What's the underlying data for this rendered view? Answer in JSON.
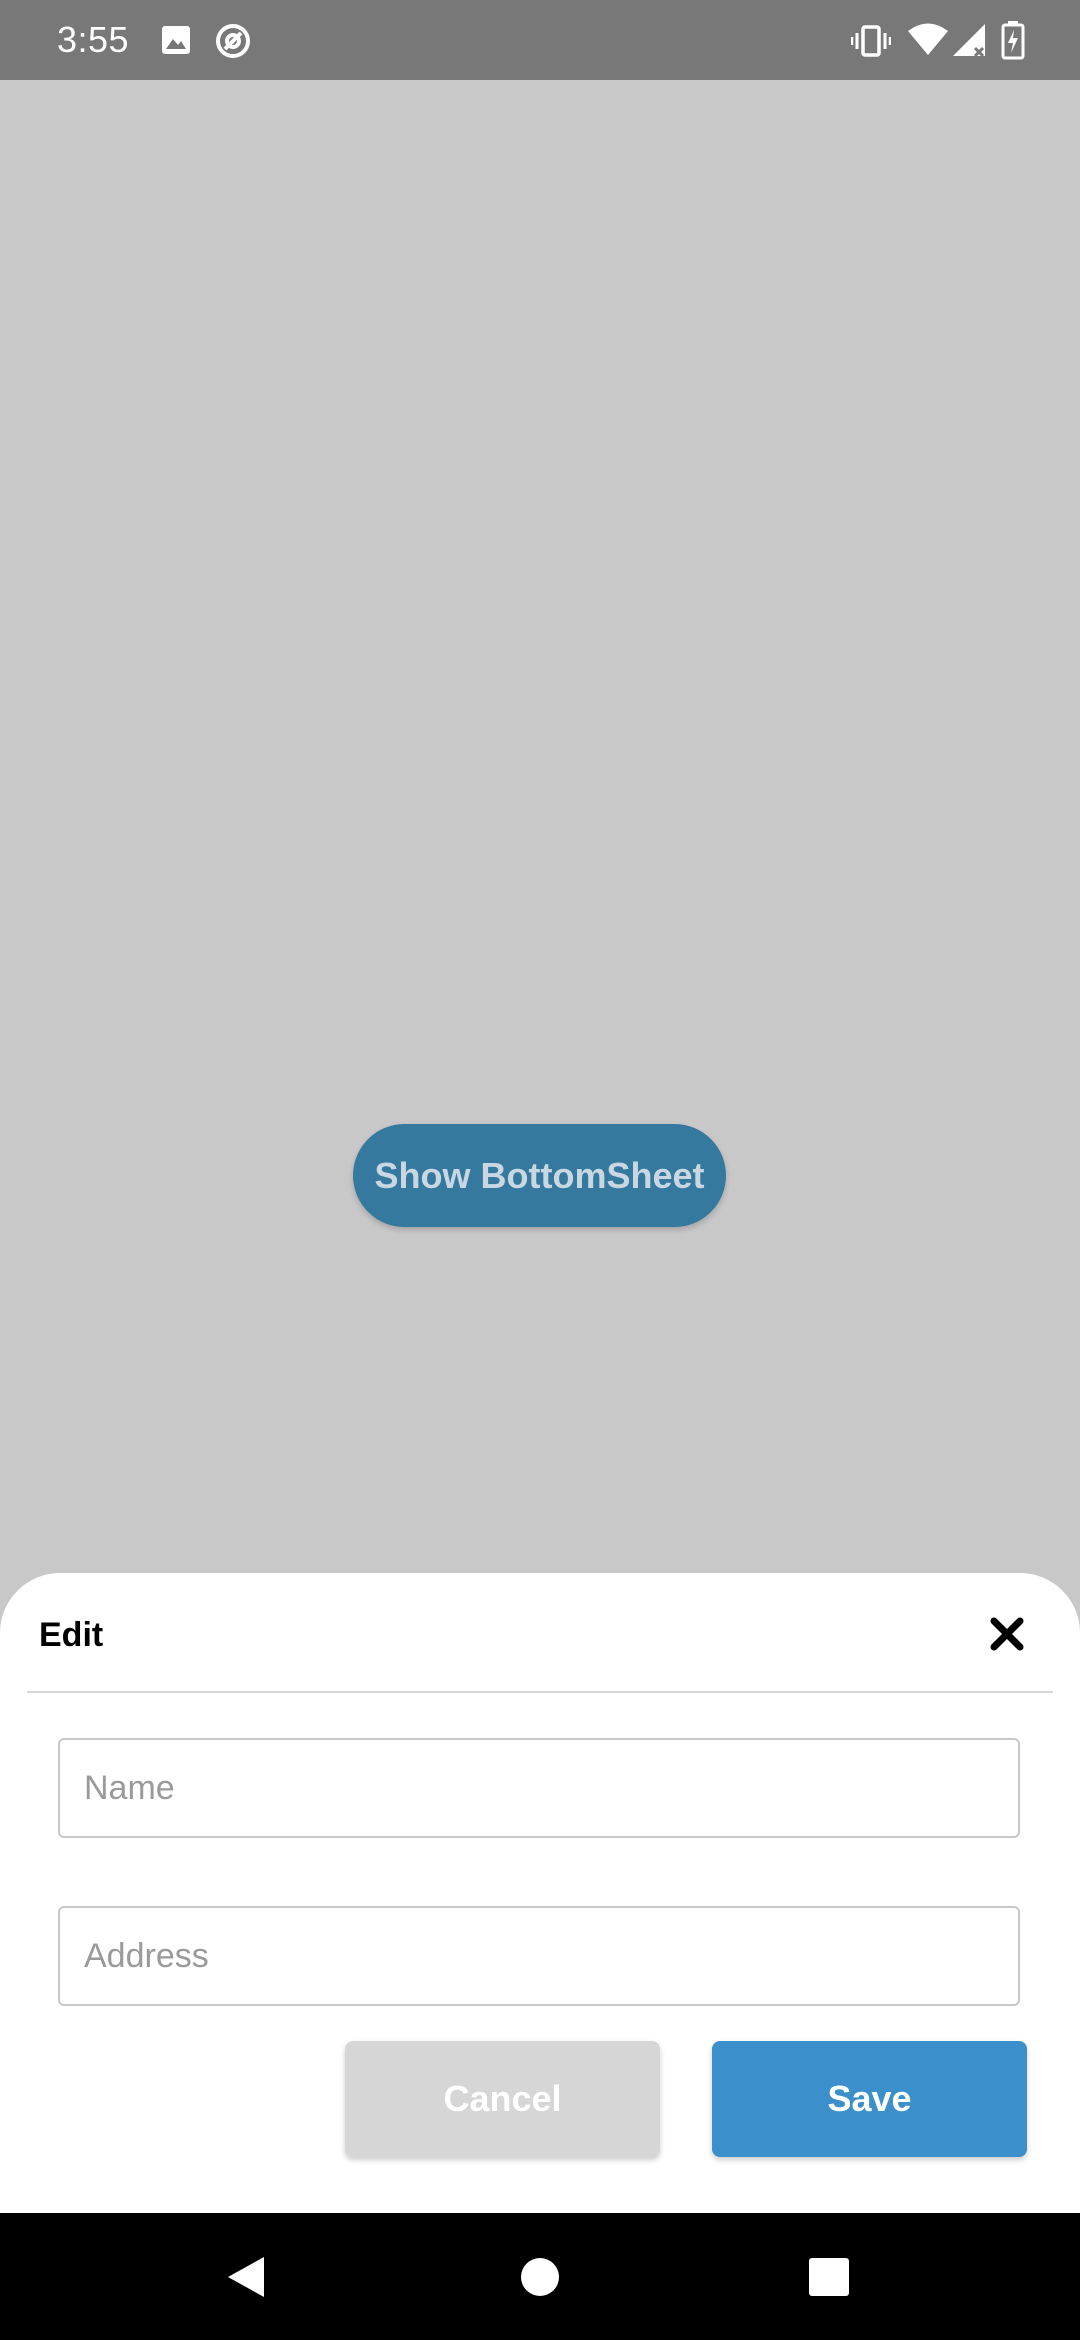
{
  "status_bar": {
    "time": "3:55",
    "left_icons": [
      "image-icon",
      "at-sign-icon"
    ],
    "right_icons": [
      "vibrate-icon",
      "wifi-icon",
      "signal-icon",
      "battery-charging-icon"
    ],
    "background_color": "#787878"
  },
  "main": {
    "show_sheet_label": "Show BottomSheet",
    "background_color": "#c8c8c8",
    "button_color": "#35799f"
  },
  "sheet": {
    "title": "Edit",
    "close_icon": "close-icon",
    "name_field": {
      "value": "",
      "placeholder": "Name"
    },
    "address_field": {
      "value": "",
      "placeholder": "Address"
    },
    "cancel_label": "Cancel",
    "save_label": "Save",
    "save_color": "#3b8fcb",
    "cancel_color": "#d6d6d6"
  },
  "nav_bar": {
    "icons": [
      "back-icon",
      "home-icon",
      "recents-icon"
    ]
  }
}
